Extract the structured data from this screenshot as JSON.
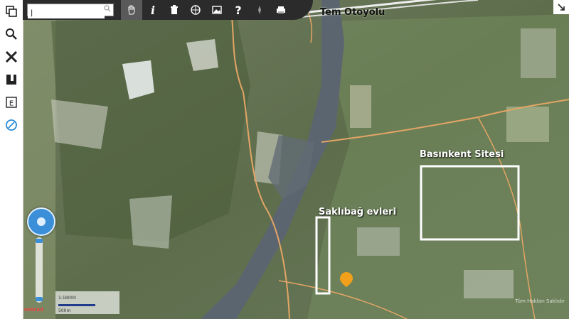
{
  "sidebar": {
    "items": [
      {
        "icon": "layers-icon"
      },
      {
        "icon": "search-icon"
      },
      {
        "icon": "tools-icon"
      },
      {
        "icon": "bookmark-icon"
      },
      {
        "icon": "e-icon",
        "label": "E"
      },
      {
        "icon": "compass-icon"
      }
    ]
  },
  "toolbar": {
    "search_value": "|",
    "tools": [
      {
        "name": "pan-tool",
        "icon": "hand-icon"
      },
      {
        "name": "info-tool",
        "label": "i"
      },
      {
        "name": "delete-tool",
        "icon": "trash-icon"
      },
      {
        "name": "globe-tool",
        "icon": "globe-icon"
      },
      {
        "name": "image-tool",
        "icon": "image-icon"
      },
      {
        "name": "help-tool",
        "label": "?"
      },
      {
        "name": "pin-tool",
        "icon": "pin-icon"
      },
      {
        "name": "print-tool",
        "icon": "print-icon"
      }
    ]
  },
  "map": {
    "labels": {
      "motorway": "Tem Otoyolu",
      "basinkent": "Basınkent Sitesi",
      "saklibag": "Saklıbağ evleri"
    },
    "scale_ratio": "1:18000",
    "scale_distance": "500m",
    "logo": "netcad",
    "attribution": "Tüm Hakları Saklıdır"
  },
  "colors": {
    "road": "#e3a565",
    "water": "#5b6570",
    "highlight_box": "#ffffff",
    "marker": "#f2a01b"
  }
}
